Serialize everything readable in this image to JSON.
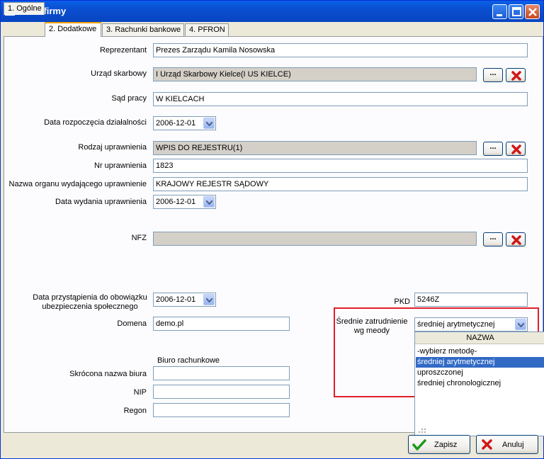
{
  "window": {
    "title": "Dane firmy"
  },
  "tabs": [
    {
      "label": "1. Ogólne",
      "active": false
    },
    {
      "label": "2. Dodatkowe",
      "active": true
    },
    {
      "label": "3. Rachunki bankowe",
      "active": false
    },
    {
      "label": "4. PFRON",
      "active": false
    }
  ],
  "form": {
    "reprezentant": {
      "label": "Reprezentant",
      "value": "Prezes Zarządu Kamila Nosowska"
    },
    "urzad": {
      "label": "Urząd skarbowy",
      "value": "I Urząd Skarbowy Kielce(I US KIELCE)"
    },
    "sad": {
      "label": "Sąd pracy",
      "value": "W KIELCACH"
    },
    "data_rozp": {
      "label": "Data rozpoczęcia działalności",
      "value": "2006-12-01"
    },
    "rodzaj": {
      "label": "Rodzaj uprawnienia",
      "value": "WPIS DO REJESTRU(1)"
    },
    "nr": {
      "label": "Nr uprawnienia",
      "value": "1823"
    },
    "organ": {
      "label": "Nazwa organu wydającego uprawnienie",
      "value": "KRAJOWY REJESTR SĄDOWY"
    },
    "data_wyd": {
      "label": "Data wydania uprawnienia",
      "value": "2006-12-01"
    },
    "nfz": {
      "label": "NFZ",
      "value": ""
    },
    "data_przyst": {
      "label": "Data przystąpienia do obowiązku ubezpieczenia społecznego",
      "value": "2006-12-01"
    },
    "domena": {
      "label": "Domena",
      "value": "demo.pl"
    },
    "pkd": {
      "label": "PKD",
      "value": "5246Z"
    },
    "srednie": {
      "label": "Średnie zatrudnienie wg meody",
      "value": "średniej arytmetycznej"
    },
    "biuro": {
      "title": "Biuro rachunkowe",
      "skrocona": {
        "label": "Skrócona nazwa biura",
        "value": ""
      },
      "nip": {
        "label": "NIP",
        "value": ""
      },
      "regon": {
        "label": "Regon",
        "value": ""
      }
    },
    "browse_label": "..."
  },
  "dropdown": {
    "header": "NAZWA",
    "options": [
      "-wybierz metodę-",
      "średniej arytmetycznej",
      "uproszczonej",
      "średniej chronologicznej"
    ],
    "selected_index": 1
  },
  "footer": {
    "save": "Zapisz",
    "cancel": "Anuluj"
  },
  "colors": {
    "highlight": "#e0202a",
    "selection": "#316ac5",
    "title_bar": "#0a4fd0"
  }
}
